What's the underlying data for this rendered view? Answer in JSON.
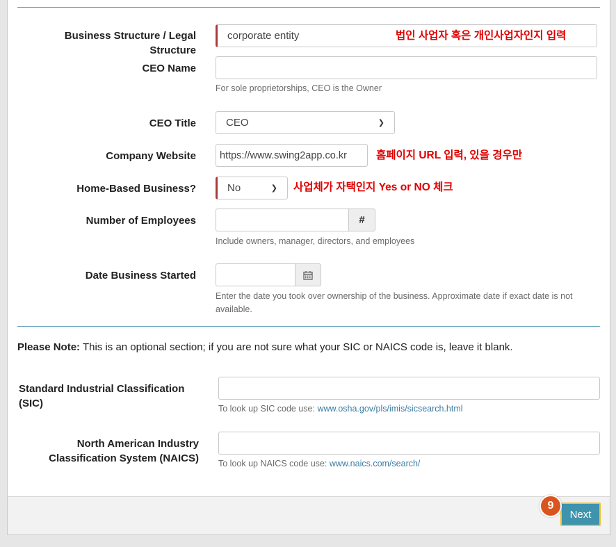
{
  "form": {
    "business_structure": {
      "label": "Business Structure / Legal Structure",
      "value": "corporate entity",
      "note": "법인 사업자 혹은 개인사업자인지 입력"
    },
    "ceo_name": {
      "label": "CEO Name",
      "value": "",
      "help": "For sole proprietorships, CEO is the Owner"
    },
    "ceo_title": {
      "label": "CEO Title",
      "selected": "CEO"
    },
    "company_website": {
      "label": "Company Website",
      "value": "https://www.swing2app.co.kr",
      "note": "홈페이지 URL 입력, 있을 경우만"
    },
    "home_based": {
      "label": "Home-Based Business?",
      "selected": "No",
      "note": "사업체가 자택인지 Yes or NO 체크"
    },
    "employees": {
      "label": "Number of Employees",
      "value": "",
      "addon": "#",
      "help": "Include owners, manager, directors, and employees"
    },
    "date_started": {
      "label": "Date Business Started",
      "value": "",
      "help": "Enter the date you took over ownership of the business. Approximate date if exact date is not available."
    }
  },
  "note_section": {
    "bold": "Please Note:",
    "text": " This is an optional section; if you are not sure what your SIC or NAICS code is, leave it blank."
  },
  "sic": {
    "label": "Standard Industrial Classification (SIC)",
    "value": "",
    "help_prefix": "To look up SIC code use: ",
    "help_link": "www.osha.gov/pls/imis/sicsearch.html"
  },
  "naics": {
    "label_line1": "North American Industry",
    "label_line2": "Classification System (NAICS)",
    "value": "",
    "help_prefix": "To look up NAICS code use: ",
    "help_link": "www.naics.com/search/"
  },
  "footer": {
    "step": "9",
    "next_label": "Next"
  }
}
